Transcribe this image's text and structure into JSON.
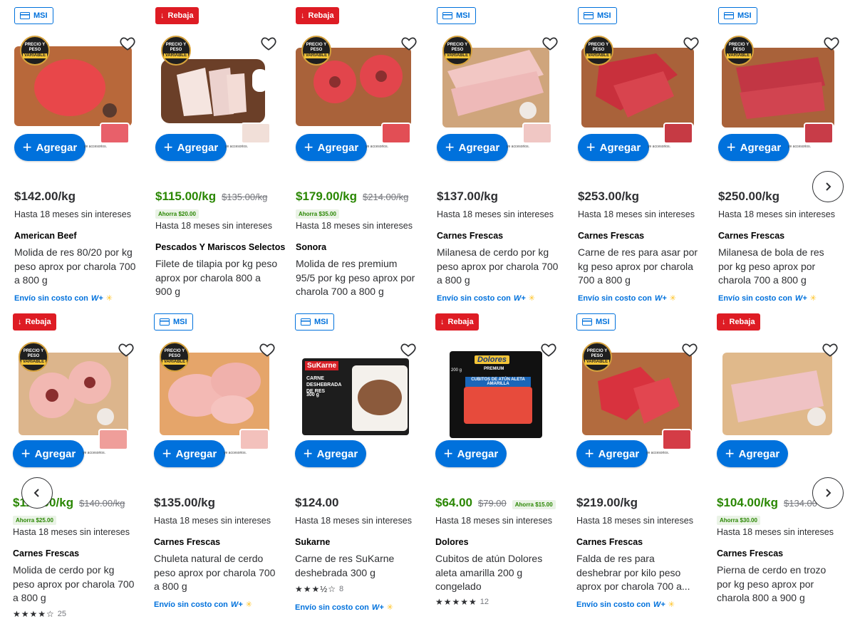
{
  "common": {
    "add_label": "Agregar",
    "msi_label": "MSI",
    "rebaja_label": "Rebaja",
    "seal_top": "PRECIO Y PESO",
    "seal_bottom": "VARIABLE",
    "acc_text": "ye accesorios.",
    "ship_text": "Envío sin costo con",
    "wplus": "W+",
    "accent_color": "#0071dc",
    "sale_color": "#2a8703",
    "rebaja_color": "#de1c24"
  },
  "row1": [
    {
      "badge": "MSI",
      "price": "$142.00/kg",
      "sale": false,
      "was": "",
      "save": "",
      "msi": "Hasta 18 meses sin intereses",
      "brand": "American Beef",
      "title": "Molida de res 80/20 por kg peso aprox por charola 700 a 800 g",
      "ship": true,
      "rating": null
    },
    {
      "badge": "Rebaja",
      "price": "$115.00/kg",
      "sale": true,
      "was": "$135.00/kg",
      "save": "Ahorra $20.00",
      "msi": "Hasta 18 meses sin intereses",
      "brand": "Pescados Y Mariscos Selectos",
      "title": "Filete de tilapia por kg peso aprox por charola 800 a 900 g",
      "ship": false,
      "rating": null
    },
    {
      "badge": "Rebaja",
      "price": "$179.00/kg",
      "sale": true,
      "was": "$214.00/kg",
      "save": "Ahorra $35.00",
      "msi": "Hasta 18 meses sin intereses",
      "brand": "Sonora",
      "title": "Molida de res premium 95/5 por kg peso aprox por charola 700 a 800 g",
      "ship": false,
      "rating": null
    },
    {
      "badge": "MSI",
      "price": "$137.00/kg",
      "sale": false,
      "was": "",
      "save": "",
      "msi": "Hasta 18 meses sin intereses",
      "brand": "Carnes Frescas",
      "title": "Milanesa de cerdo por kg peso aprox por charola 700 a 800 g",
      "ship": true,
      "rating": null
    },
    {
      "badge": "MSI",
      "price": "$253.00/kg",
      "sale": false,
      "was": "",
      "save": "",
      "msi": "Hasta 18 meses sin intereses",
      "brand": "Carnes Frescas",
      "title": "Carne de res para asar por kg peso aprox por charola 700 a 800 g",
      "ship": true,
      "rating": null
    },
    {
      "badge": "MSI",
      "price": "$250.00/kg",
      "sale": false,
      "was": "",
      "save": "",
      "msi": "Hasta 18 meses sin intereses",
      "brand": "Carnes Frescas",
      "title": "Milanesa de bola de res por kg peso aprox por charola 700 a 800 g",
      "ship": true,
      "rating": null
    }
  ],
  "row2": [
    {
      "badge": "Rebaja",
      "price": "$115.00/kg",
      "sale": true,
      "was": "$140.00/kg",
      "save": "Ahorra $25.00",
      "msi": "Hasta 18 meses sin intereses",
      "brand": "Carnes Frescas",
      "title": "Molida de cerdo por kg peso aprox por charola 700 a 800 g",
      "ship": false,
      "rating": {
        "stars": "★★★★☆",
        "count": "25"
      }
    },
    {
      "badge": "MSI",
      "price": "$135.00/kg",
      "sale": false,
      "was": "",
      "save": "",
      "msi": "Hasta 18 meses sin intereses",
      "brand": "Carnes Frescas",
      "title": "Chuleta natural de cerdo peso aprox por charola 700 a 800 g",
      "ship": true,
      "rating": null
    },
    {
      "badge": "MSI",
      "price": "$124.00",
      "sale": false,
      "was": "",
      "save": "",
      "msi": "Hasta 18 meses sin intereses",
      "brand": "Sukarne",
      "title": "Carne de res SuKarne deshebrada 300 g",
      "ship": true,
      "rating": {
        "stars": "★★★½☆",
        "count": "8"
      }
    },
    {
      "badge": "Rebaja",
      "price": "$64.00",
      "sale": true,
      "was": "$79.00",
      "save": "Ahorra $15.00",
      "msi": "Hasta 18 meses sin intereses",
      "brand": "Dolores",
      "title": "Cubitos de atún Dolores aleta amarilla 200 g congelado",
      "ship": false,
      "rating": {
        "stars": "★★★★★",
        "count": "12"
      }
    },
    {
      "badge": "MSI",
      "price": "$219.00/kg",
      "sale": false,
      "was": "",
      "save": "",
      "msi": "Hasta 18 meses sin intereses",
      "brand": "Carnes Frescas",
      "title": "Falda de res para deshebrar por kilo peso aprox por charola 700 a...",
      "ship": true,
      "rating": null
    },
    {
      "badge": "Rebaja",
      "price": "$104.00/kg",
      "sale": true,
      "was": "$134.00",
      "save": "Ahorra $30.00",
      "msi": "Hasta 18 meses sin intereses",
      "brand": "Carnes Frescas",
      "title": "Pierna de cerdo en trozo por kg peso aprox por charola 800 a 900 g",
      "ship": false,
      "rating": null
    }
  ],
  "packaging": {
    "sukarne_logo": "SuKarne",
    "sukarne_title": "CARNE DESHEBRADA DE RES",
    "sukarne_weight": "300 g",
    "dolores_logo": "Dolores",
    "dolores_premium": "PREMIUM",
    "dolores_title": "CUBITOS DE ATÚN ALETA AMARILLA",
    "dolores_weight": "200 g"
  },
  "icons": {
    "heart": "heart-icon",
    "card": "credit-card-icon",
    "down": "arrow-down-icon",
    "plus": "plus-icon",
    "next": "chevron-right-icon",
    "prev": "chevron-left-icon"
  }
}
